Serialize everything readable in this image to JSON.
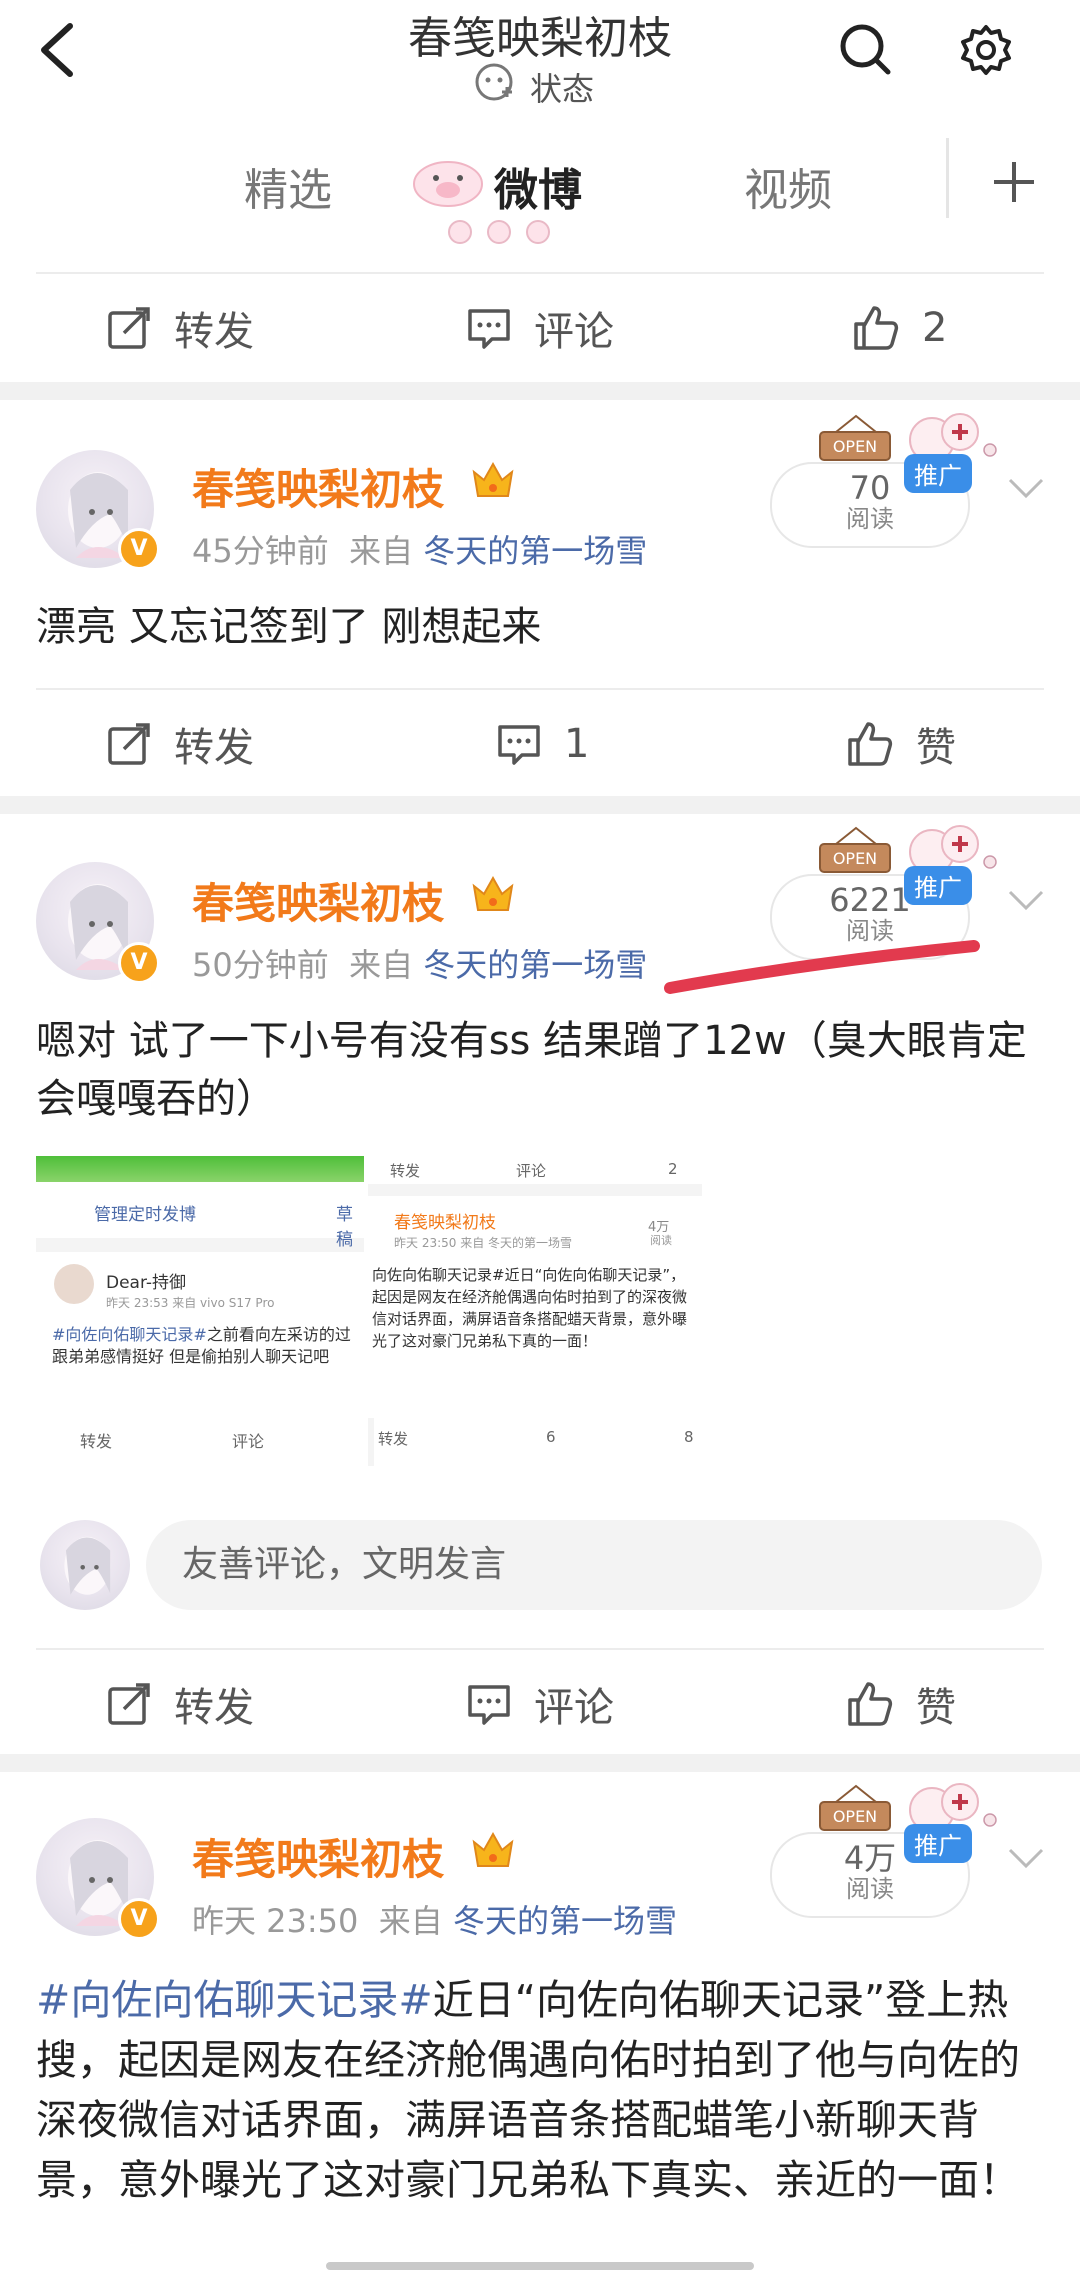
{
  "header": {
    "title": "春笺映梨初枝",
    "status_label": "状态"
  },
  "tabs": [
    {
      "label": "精选"
    },
    {
      "label": "微博"
    },
    {
      "label": "视频"
    }
  ],
  "actions_top": {
    "repost": "转发",
    "comment": "评论",
    "like": "2"
  },
  "posts": [
    {
      "name": "春笺映梨初枝",
      "time": "45分钟前",
      "from_label": "来自",
      "source": "冬天的第一场雪",
      "reads": "70",
      "reads_label": "阅读",
      "promo": "推广",
      "text": "漂亮 又忘记签到了 刚想起来",
      "actions": {
        "repost": "转发",
        "comment": "1",
        "like": "赞"
      }
    },
    {
      "name": "春笺映梨初枝",
      "time": "50分钟前",
      "from_label": "来自",
      "source": "冬天的第一场雪",
      "reads": "6221",
      "reads_label": "阅读",
      "promo": "推广",
      "text": "嗯对 试了一下小号有没有ss 结果蹭了12w（臭大眼肯定会嘎嘎吞的）",
      "comment_placeholder": "友善评论，文明发言",
      "actions": {
        "repost": "转发",
        "comment": "评论",
        "like": "赞"
      },
      "thumb1": {
        "link": "管理定时发博",
        "link2": "草稿",
        "user": "Dear-持御",
        "usermeta": "昨天 23:53  来自 vivo S17 Pro",
        "topic": "#向佐向佑聊天记录#",
        "body": "之前看向左采访的过跟弟弟感情挺好 但是偷拍别人聊天记吧",
        "repost": "转发",
        "comment": "评论"
      },
      "thumb2": {
        "repost": "转发",
        "comment": "评论",
        "like": "2",
        "name": "春笺映梨初枝",
        "meta": "昨天 23:50  来自 冬天的第一场雪",
        "reads": "4万",
        "reads_label": "阅读",
        "body": "向佐向佑聊天记录#近日“向佐向佑聊天记录”，起因是网友在经济舱偶遇向佑时拍到了的深夜微信对话界面，满屏语音条搭配蜡天背景，意外曝光了这对豪门兄弟私下真的一面！",
        "repost2": "转发",
        "comment2": "6",
        "like2": "8"
      }
    },
    {
      "name": "春笺映梨初枝",
      "time": "昨天 23:50",
      "from_label": "来自",
      "source": "冬天的第一场雪",
      "reads": "4万",
      "reads_label": "阅读",
      "promo": "推广",
      "topic": "#向佐向佑聊天记录#",
      "text": "近日“向佐向佑聊天记录”登上热搜，起因是网友在经济舱偶遇向佑时拍到了他与向佐的深夜微信对话界面，满屏语音条搭配蜡笔小新聊天背景，意外曝光了这对豪门兄弟私下真实、亲近的一面！"
    }
  ],
  "colors": {
    "accent_name": "#f27a1a",
    "link": "#4b6aa8",
    "promo": "#3a8ee8",
    "underline": "#e23a4e"
  }
}
